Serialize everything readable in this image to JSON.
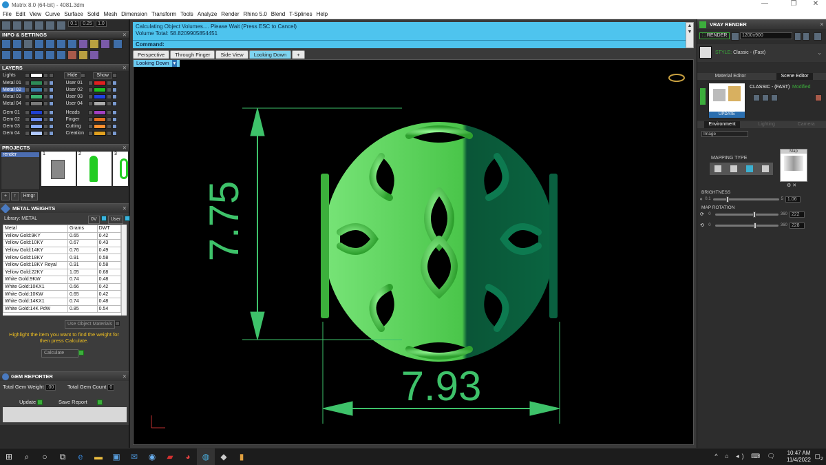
{
  "window": {
    "title": "Matrix 8.0 (64-bit) - 4081.3dm",
    "min": "—",
    "max": "❐",
    "close": "✕"
  },
  "menu": [
    "File",
    "Edit",
    "View",
    "Curve",
    "Surface",
    "Solid",
    "Mesh",
    "Dimension",
    "Transform",
    "Tools",
    "Analyze",
    "Render",
    "Rhino 5.0",
    "Blend",
    "T-Splines",
    "Help"
  ],
  "toolbar": {
    "v1": "0.1",
    "v2": "0.25",
    "v3": "1.0"
  },
  "left": {
    "info_title": "INFO & SETTINGS",
    "layers_title": "LAYERS",
    "lights": "Lights",
    "hide": "Hide",
    "show": "Show",
    "metals": [
      "Metal 01",
      "Metal 02",
      "Metal 03",
      "Metal 04"
    ],
    "metal_colors": [
      "#2e8b57",
      "#3a7fa8",
      "#3cb371",
      "#7a7a7a"
    ],
    "users": [
      "User 01",
      "User 02",
      "User 03",
      "User 04"
    ],
    "user_colors": [
      "#e02020",
      "#20c020",
      "#2040e0",
      "#aaaaaa"
    ],
    "gems": [
      "Gem 01",
      "Gem 02",
      "Gem 03",
      "Gem 04"
    ],
    "gem_colors": [
      "#2040d0",
      "#6a8af0",
      "#88aaff",
      "#b0c8ff"
    ],
    "others": [
      "Heads",
      "Finger",
      "Cutting",
      "Creation"
    ],
    "other_colors": [
      "#a040c0",
      "#e07020",
      "#ff9030",
      "#e0a020"
    ],
    "projects_title": "PROJECTS",
    "project_item": "render",
    "thumbs": [
      "1",
      "2",
      "3"
    ],
    "hmgr": "Hmgr"
  },
  "metal_weights": {
    "title": "METAL WEIGHTS",
    "library": "Library: METAL",
    "btn1": "0V",
    "btn2": "User",
    "headers": [
      "Metal",
      "Grams",
      "DWT"
    ],
    "rows": [
      [
        "Yellow Gold:9KY",
        "0.65",
        "0.42"
      ],
      [
        "Yellow Gold:10KY",
        "0.67",
        "0.43"
      ],
      [
        "Yellow Gold:14KY",
        "0.76",
        "0.49"
      ],
      [
        "Yellow Gold:18KY",
        "0.91",
        "0.58"
      ],
      [
        "Yellow Gold:18KY Royal",
        "0.91",
        "0.58"
      ],
      [
        "Yellow Gold:22KY",
        "1.05",
        "0.68"
      ],
      [
        "White Gold:9KW",
        "0.74",
        "0.48"
      ],
      [
        "White Gold:10KX1",
        "0.66",
        "0.42"
      ],
      [
        "White Gold:10KW",
        "0.65",
        "0.42"
      ],
      [
        "White Gold:14KX1",
        "0.74",
        "0.48"
      ],
      [
        "White Gold:14K PdW",
        "0.85",
        "0.54"
      ]
    ],
    "use_obj": "Use Object Materials",
    "hint": "Highlight the item you want to find the weight for then press Calculate.",
    "calc": "Calculate"
  },
  "gem_reporter": {
    "title": "GEM REPORTER",
    "total_weight_label": "Total Gem Weight",
    "total_weight": ".00",
    "total_count_label": "Total Gem Count",
    "total_count": "0",
    "update": "Update",
    "save": "Save Report"
  },
  "center": {
    "status1": "Calculating Object Volumes.... Please Wait (Press ESC to Cancel)",
    "status2": "Volume Total: 58.8209905854451",
    "command": "Command:",
    "tabs": [
      "Perspective",
      "Through Finger",
      "Side View",
      "Looking Down",
      "+"
    ],
    "viewport_label": "Looking Down",
    "dim_vertical": "7.75",
    "dim_horizontal": "7.93"
  },
  "right": {
    "title": "VRAY RENDER",
    "render": "RENDER",
    "resolution": "1200x900",
    "style_label": "STYLE:",
    "style": "Classic - (Fast)",
    "tab_material": "Material Editor",
    "tab_scene": "Scene Editor",
    "classic": "CLASSIC - (FAST)",
    "modified": "Modified",
    "update": "UPDATE",
    "sub_env": "Environment",
    "sub_light": "Lighting",
    "sub_cam": "Camera",
    "image": "Image",
    "mapping_type": "MAPPING TYPE",
    "map": "Map",
    "brightness": "BRIGHTNESS",
    "b_min": "0.1",
    "b_max": "5",
    "b_val": "1.06",
    "b_level": 0.22,
    "map_rotation": "MAP ROTATION",
    "r_min": "0",
    "r_max": "360",
    "r1": "222",
    "r2": "228",
    "r1_level": 0.617,
    "r2_level": 0.633
  },
  "taskbar": {
    "time": "10:47 AM",
    "date": "11/4/2022",
    "notif": "2"
  }
}
